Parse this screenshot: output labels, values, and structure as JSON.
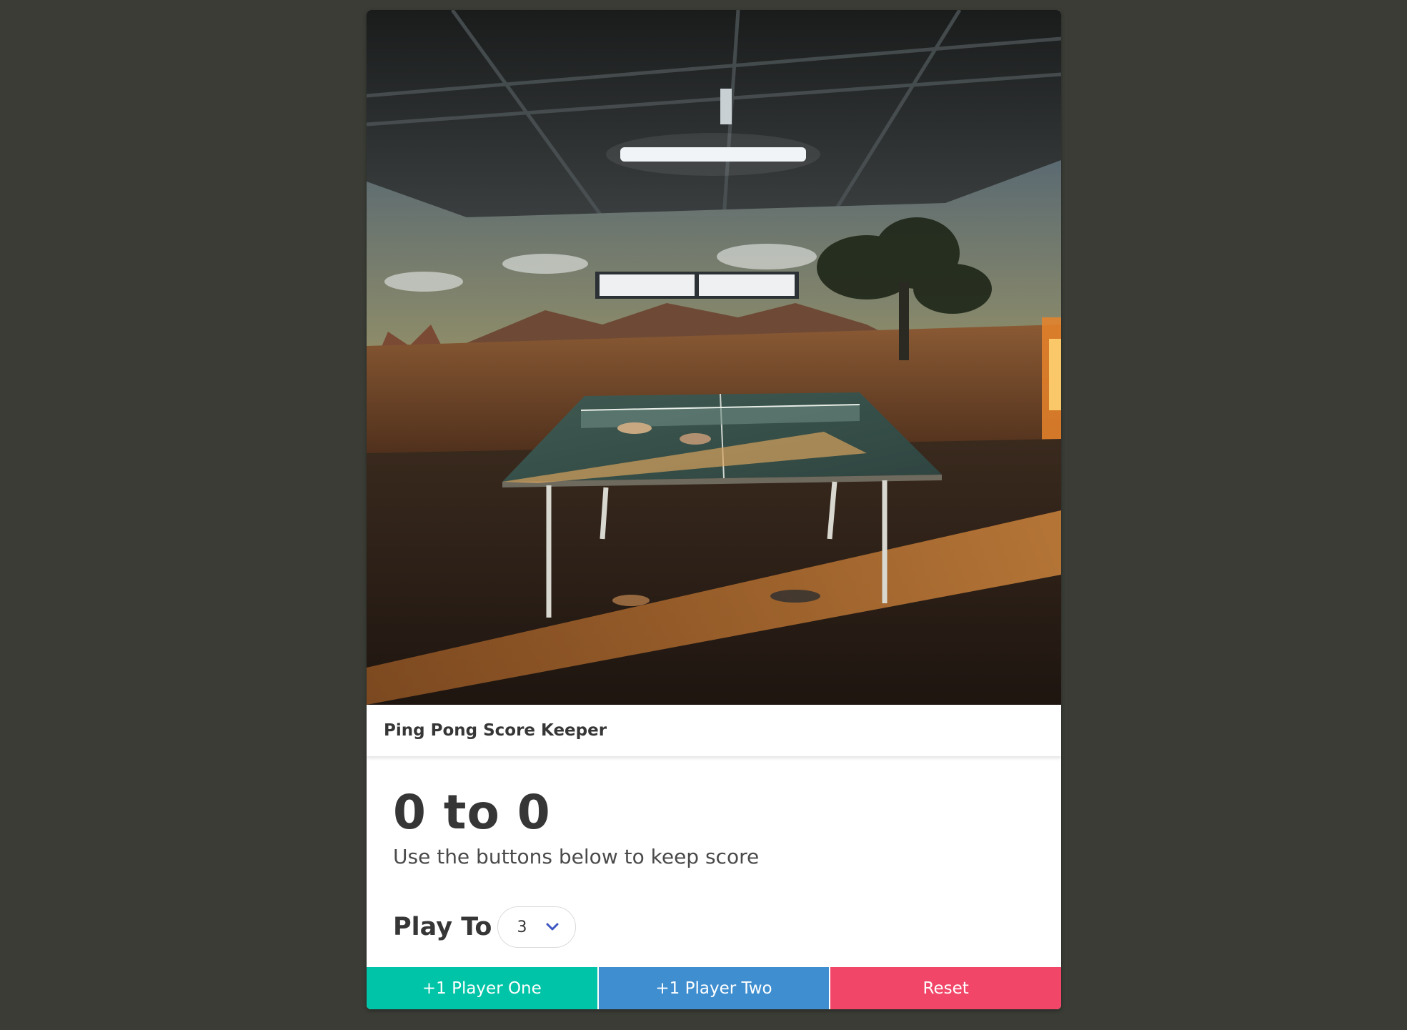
{
  "card": {
    "title": "Ping Pong Score Keeper"
  },
  "photo": {
    "alt": "Ping pong table in a shed with painted desert mural"
  },
  "score": {
    "player_one": 0,
    "separator": "to",
    "player_two": 0,
    "display": "0 to 0",
    "subtitle": "Use the buttons below to keep score"
  },
  "play_to": {
    "label": "Play To",
    "selected": "3"
  },
  "buttons": {
    "player_one": "+1 Player One",
    "player_two": "+1 Player Two",
    "reset": "Reset"
  },
  "colors": {
    "background": "#3b3c36",
    "player_one": "#00c4a7",
    "player_two": "#3e8ed0",
    "reset": "#f14668",
    "chevron": "#3e56c4"
  }
}
